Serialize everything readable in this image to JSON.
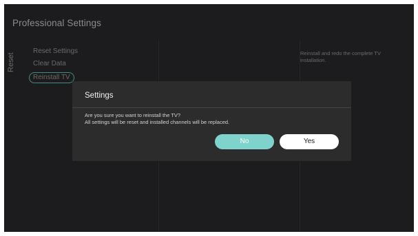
{
  "page_title": "Professional Settings",
  "category": "Reset",
  "menu": {
    "items": [
      {
        "label": "Reset Settings"
      },
      {
        "label": "Clear Data"
      },
      {
        "label": "Reinstall TV"
      }
    ],
    "focused_index": 2
  },
  "help_text": "Reinstall and redo the complete TV installation.",
  "dialog": {
    "title": "Settings",
    "message_line1": "Are you sure you want to reinstall the TV?",
    "message_line2": "All settings will be reset and installed channels will be replaced.",
    "no_label": "No",
    "yes_label": "Yes",
    "focused_button": "No"
  },
  "colors": {
    "background": "#1c1c1e",
    "dialog_background": "#2c2c2c",
    "accent": "#7fd3cc",
    "focus_outline": "#3c8f88"
  }
}
